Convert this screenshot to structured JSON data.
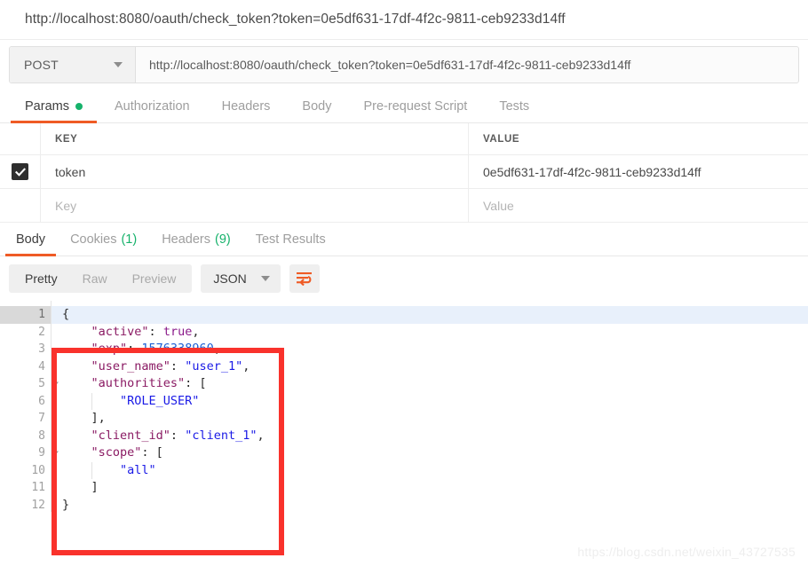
{
  "url_banner": {
    "text": "http://localhost:8080/oauth/check_token?token=0e5df631-17df-4f2c-9811-ceb9233d14ff"
  },
  "request_bar": {
    "method": "POST",
    "url": "http://localhost:8080/oauth/check_token?token=0e5df631-17df-4f2c-9811-ceb9233d14ff",
    "method_caret_icon": "chevron-down-icon"
  },
  "request_tabs": [
    {
      "label": "Params",
      "active": true,
      "indicator": "green-dot"
    },
    {
      "label": "Authorization",
      "active": false
    },
    {
      "label": "Headers",
      "active": false
    },
    {
      "label": "Body",
      "active": false
    },
    {
      "label": "Pre-request Script",
      "active": false
    },
    {
      "label": "Tests",
      "active": false
    }
  ],
  "params_table": {
    "headers": {
      "key": "KEY",
      "value": "VALUE"
    },
    "rows": [
      {
        "checked": true,
        "key": "token",
        "value": "0e5df631-17df-4f2c-9811-ceb9233d14ff"
      }
    ],
    "empty_row": {
      "key_placeholder": "Key",
      "value_placeholder": "Value"
    },
    "check_icon": "check-icon"
  },
  "response_tabs": [
    {
      "label": "Body",
      "count": "",
      "active": true
    },
    {
      "label": "Cookies",
      "count": "(1)",
      "active": false
    },
    {
      "label": "Headers",
      "count": "(9)",
      "active": false
    },
    {
      "label": "Test Results",
      "count": "",
      "active": false
    }
  ],
  "response_toolbar": {
    "view_modes": [
      {
        "label": "Pretty",
        "active": true
      },
      {
        "label": "Raw",
        "active": false
      },
      {
        "label": "Preview",
        "active": false
      }
    ],
    "format": "JSON",
    "format_caret_icon": "chevron-down-icon",
    "wrap_icon": "word-wrap-icon",
    "wrap_icon_color": "#ef5b25"
  },
  "code": {
    "lines": [
      {
        "n": 1,
        "fold": true,
        "current": true,
        "tokens": [
          {
            "t": "{",
            "c": "pn"
          }
        ]
      },
      {
        "n": 2,
        "fold": false,
        "current": false,
        "tokens": [
          {
            "t": "    \"active\"",
            "c": "k"
          },
          {
            "t": ": ",
            "c": "pn"
          },
          {
            "t": "true",
            "c": "b"
          },
          {
            "t": ",",
            "c": "pn"
          }
        ]
      },
      {
        "n": 3,
        "fold": false,
        "current": false,
        "tokens": [
          {
            "t": "    \"exp\"",
            "c": "k"
          },
          {
            "t": ": ",
            "c": "pn"
          },
          {
            "t": "1576338960",
            "c": "n"
          },
          {
            "t": ",",
            "c": "pn"
          }
        ]
      },
      {
        "n": 4,
        "fold": false,
        "current": false,
        "tokens": [
          {
            "t": "    \"user_name\"",
            "c": "k"
          },
          {
            "t": ": ",
            "c": "pn"
          },
          {
            "t": "\"user_1\"",
            "c": "s"
          },
          {
            "t": ",",
            "c": "pn"
          }
        ]
      },
      {
        "n": 5,
        "fold": true,
        "current": false,
        "tokens": [
          {
            "t": "    \"authorities\"",
            "c": "k"
          },
          {
            "t": ": [",
            "c": "pn"
          }
        ]
      },
      {
        "n": 6,
        "fold": false,
        "current": false,
        "tokens": [
          {
            "t": "        ",
            "c": "pn"
          },
          {
            "t": "\"ROLE_USER\"",
            "c": "s"
          }
        ]
      },
      {
        "n": 7,
        "fold": false,
        "current": false,
        "tokens": [
          {
            "t": "    ],",
            "c": "pn"
          }
        ]
      },
      {
        "n": 8,
        "fold": false,
        "current": false,
        "tokens": [
          {
            "t": "    \"client_id\"",
            "c": "k"
          },
          {
            "t": ": ",
            "c": "pn"
          },
          {
            "t": "\"client_1\"",
            "c": "s"
          },
          {
            "t": ",",
            "c": "pn"
          }
        ]
      },
      {
        "n": 9,
        "fold": true,
        "current": false,
        "tokens": [
          {
            "t": "    \"scope\"",
            "c": "k"
          },
          {
            "t": ": [",
            "c": "pn"
          }
        ]
      },
      {
        "n": 10,
        "fold": false,
        "current": false,
        "tokens": [
          {
            "t": "        ",
            "c": "pn"
          },
          {
            "t": "\"all\"",
            "c": "s"
          }
        ]
      },
      {
        "n": 11,
        "fold": false,
        "current": false,
        "tokens": [
          {
            "t": "    ]",
            "c": "pn"
          }
        ]
      },
      {
        "n": 12,
        "fold": false,
        "current": false,
        "tokens": [
          {
            "t": "}",
            "c": "pn"
          }
        ]
      }
    ],
    "response_body": {
      "active": true,
      "exp": 1576338960,
      "user_name": "user_1",
      "authorities": [
        "ROLE_USER"
      ],
      "client_id": "client_1",
      "scope": [
        "all"
      ]
    }
  },
  "annotation": {
    "highlight_color": "#f9322c"
  },
  "watermark": {
    "text": "https://blog.csdn.net/weixin_43727535"
  }
}
